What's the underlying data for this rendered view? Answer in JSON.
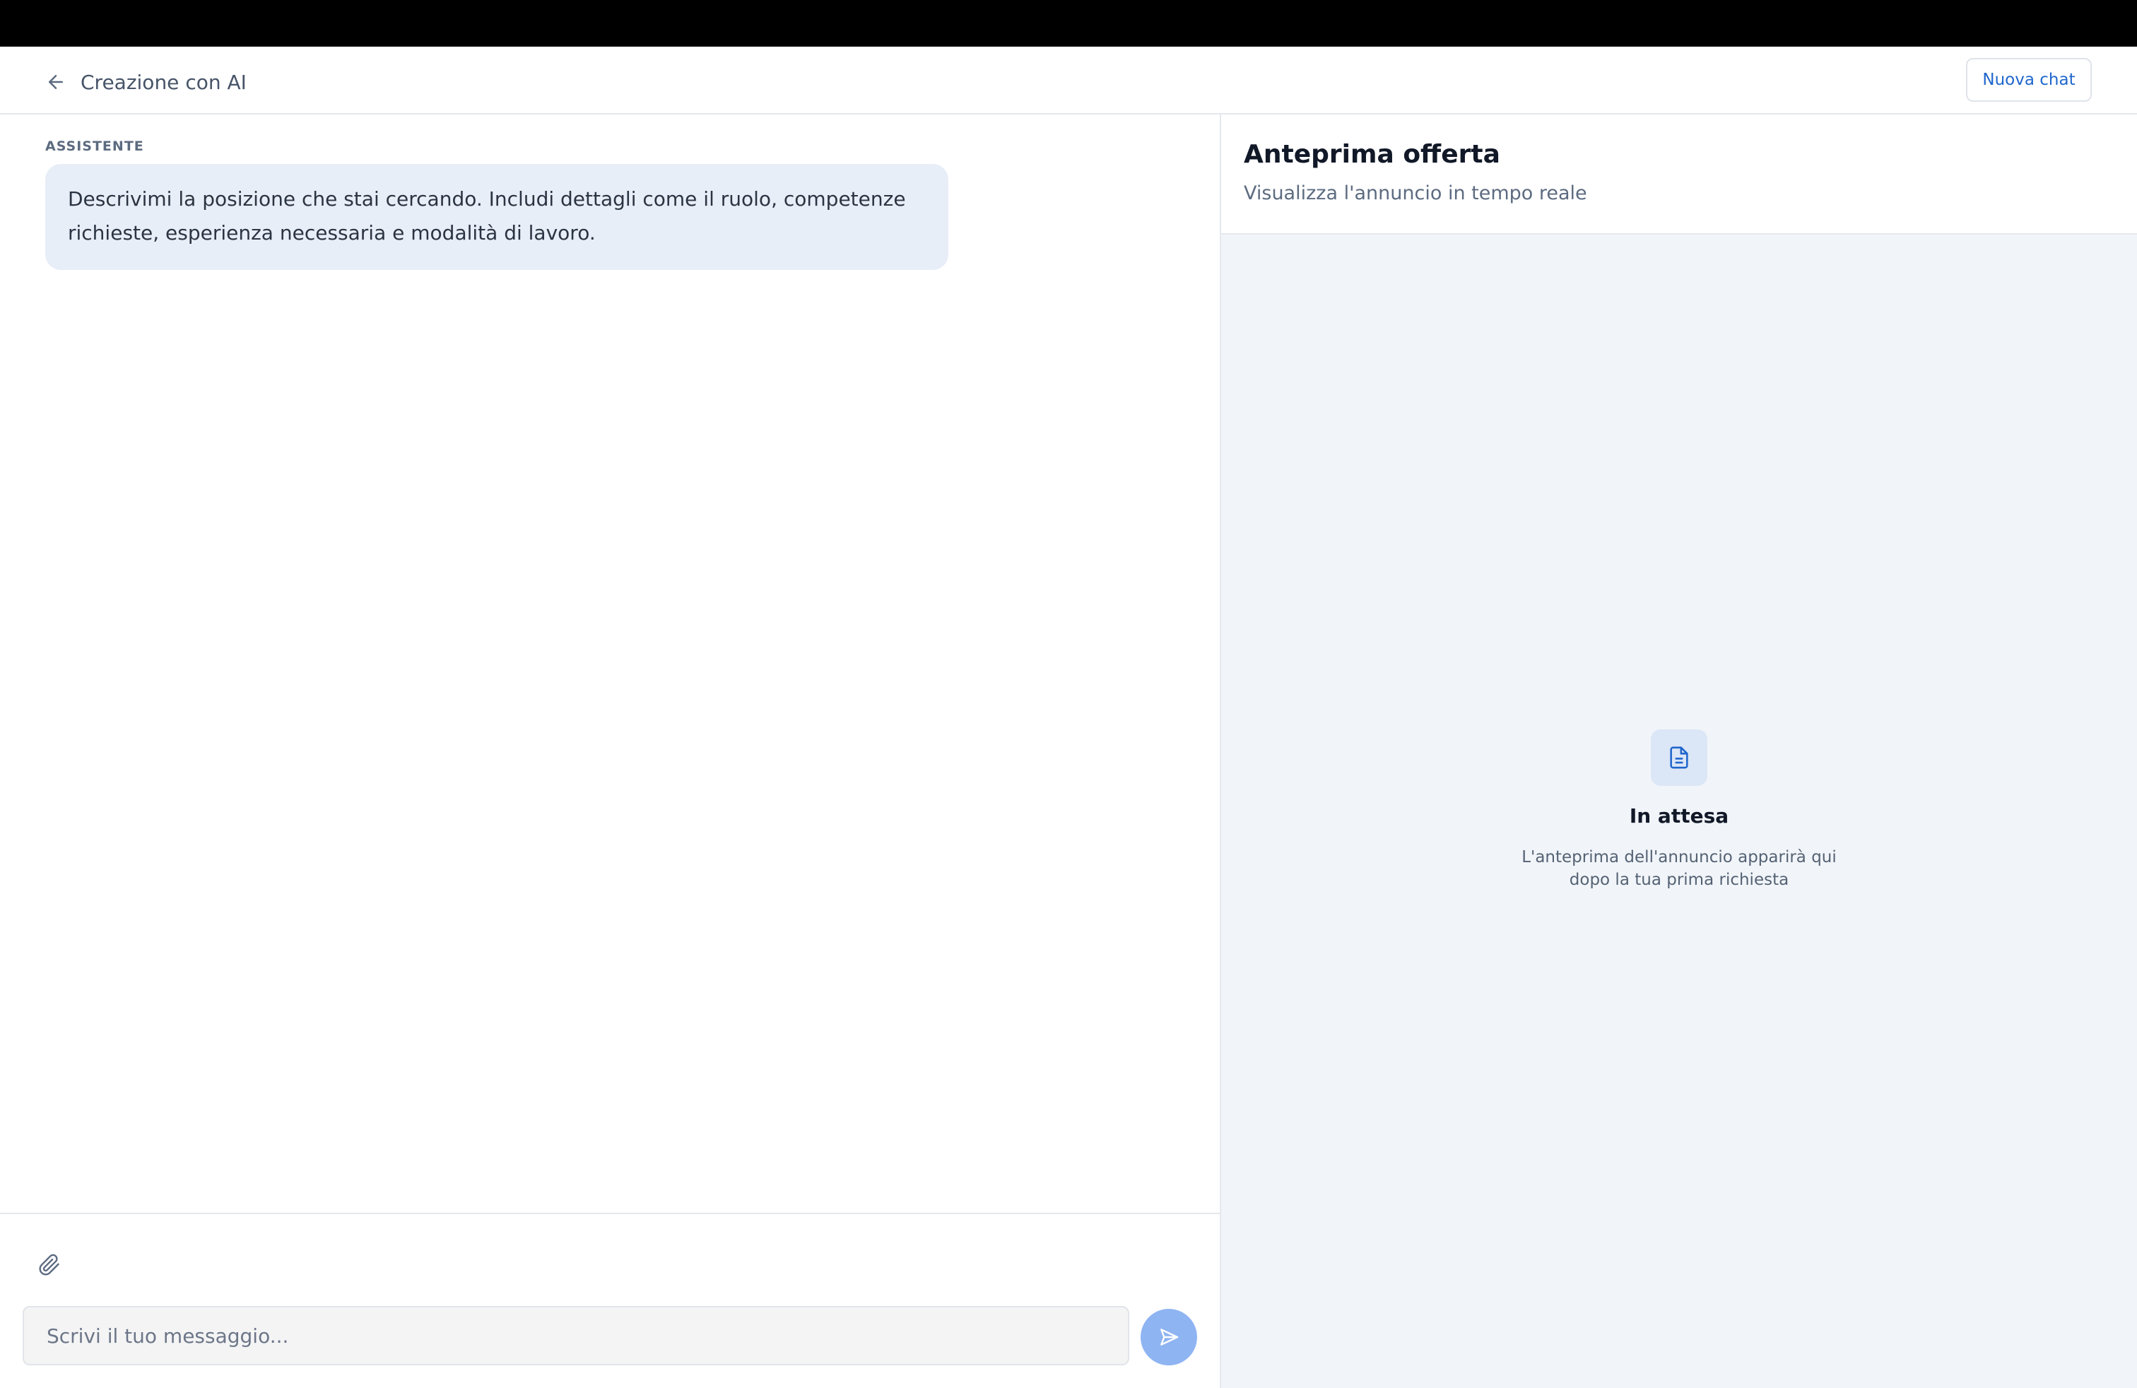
{
  "header": {
    "back_icon": "arrow-left-icon",
    "title": "Creazione con AI",
    "new_chat_label": "Nuova chat"
  },
  "chat": {
    "messages": [
      {
        "role_label": "ASSISTENTE",
        "text": "Descrivimi la posizione che stai cercando. Includi dettagli come il ruolo, competenze richieste, esperienza necessaria e modalità di lavoro."
      }
    ],
    "attach_icon": "paperclip-icon",
    "input": {
      "value": "",
      "placeholder": "Scrivi il tuo messaggio..."
    },
    "send_icon": "send-icon"
  },
  "preview": {
    "title": "Anteprima offerta",
    "subtitle": "Visualizza l'annuncio in tempo reale",
    "empty_state": {
      "icon": "document-icon",
      "title": "In attesa",
      "description": "L'anteprima dell'annuncio apparirà qui dopo la tua prima richiesta"
    }
  },
  "colors": {
    "accent": "#1f66cc",
    "bubble": "#e8eef8",
    "send_button": "#8fb4f2",
    "preview_background": "#f1f5f9"
  }
}
